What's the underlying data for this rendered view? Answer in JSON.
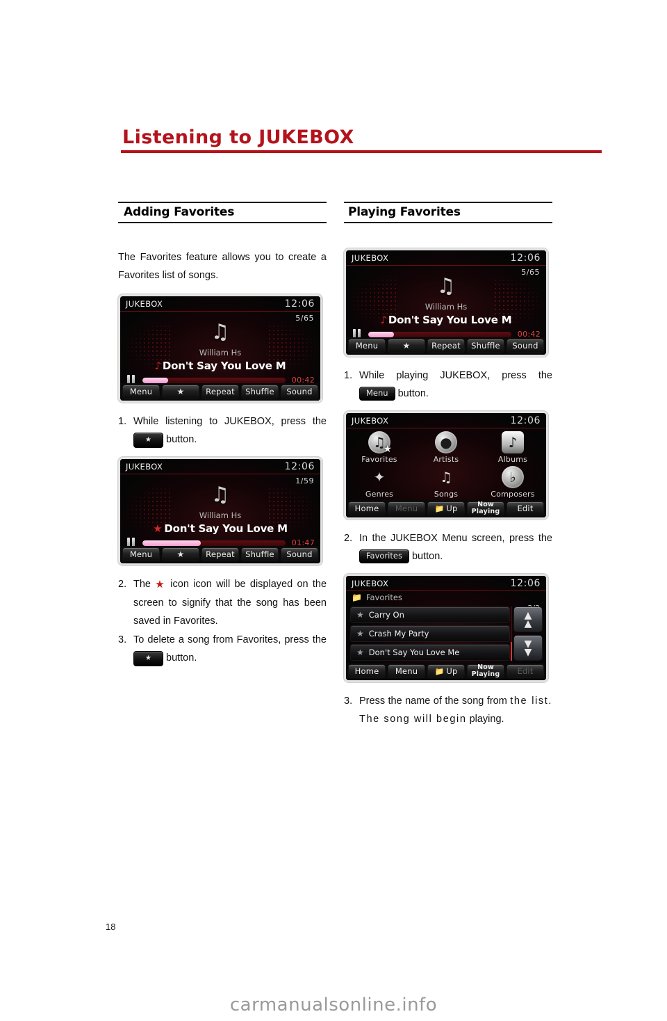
{
  "page": {
    "chapter_title": "Listening to JUKEBOX",
    "page_number": "18",
    "watermark": "carmanualsonline.info"
  },
  "left_column": {
    "heading": "Adding Favorites",
    "intro": "The Favorites feature allows you to create a Favorites list of songs.",
    "steps": [
      {
        "num": "1.",
        "text_before": "While listening to JUKEBOX, press the",
        "chip": "★",
        "text_after": "button."
      },
      {
        "num": "2.",
        "text_before": "The",
        "inline_icon": "★",
        "text_after": "icon  icon will be displayed on the screen to signify that the song has been saved in Favorites."
      },
      {
        "num": "3.",
        "text_before": "To delete a song from Favorites, press the",
        "chip": "★",
        "text_after": "button."
      }
    ],
    "shot_now_playing": {
      "source": "JUKEBOX",
      "clock": "12:06",
      "counter": "5/65",
      "artist": "William Hs",
      "title": "Don't Say You Love M",
      "lead_icon": "music-note",
      "elapsed": "00:42",
      "progress_percent": 18,
      "buttons": [
        "Menu",
        "★",
        "Repeat",
        "Shuffle",
        "Sound"
      ]
    },
    "shot_favorited": {
      "source": "JUKEBOX",
      "clock": "12:06",
      "counter": "1/59",
      "artist": "William Hs",
      "title": "Don't Say You Love M",
      "lead_icon": "red-star",
      "elapsed": "01:47",
      "progress_percent": 41,
      "buttons": [
        "Menu",
        "★",
        "Repeat",
        "Shuffle",
        "Sound"
      ]
    }
  },
  "right_column": {
    "heading": "Playing Favorites",
    "steps": [
      {
        "num": "1.",
        "text_before": "While playing JUKEBOX, press the",
        "chip": "Menu",
        "text_after": "button."
      },
      {
        "num": "2.",
        "text_before": "In the JUKEBOX Menu screen, press the",
        "chip": "Favorites",
        "text_after": "button."
      },
      {
        "num": "3.",
        "line1": "Press the name of the song from",
        "line2": "the list. The song will begin",
        "line3": "playing."
      }
    ],
    "shot_now_playing": {
      "source": "JUKEBOX",
      "clock": "12:06",
      "counter": "5/65",
      "artist": "William Hs",
      "title": "Don't Say You Love M",
      "lead_icon": "music-note",
      "elapsed": "00:42",
      "progress_percent": 18,
      "buttons": [
        "Menu",
        "★",
        "Repeat",
        "Shuffle",
        "Sound"
      ]
    },
    "shot_menu": {
      "source": "JUKEBOX",
      "clock": "12:06",
      "items": [
        {
          "label": "Favorites",
          "icon": "favorites-note-star-icon"
        },
        {
          "label": "Artists",
          "icon": "artist-person-icon"
        },
        {
          "label": "Albums",
          "icon": "album-note-icon"
        },
        {
          "label": "Genres",
          "icon": "genres-guitar-icon"
        },
        {
          "label": "Songs",
          "icon": "songs-note-icon"
        },
        {
          "label": "Composers",
          "icon": "composers-baton-icon"
        }
      ],
      "bottom_buttons": [
        {
          "label": "Home",
          "disabled": false
        },
        {
          "label": "Menu",
          "disabled": true
        },
        {
          "label": "Up",
          "disabled": false,
          "icon": "folder-up-icon"
        },
        {
          "label": "Now Playing",
          "line1": "Now",
          "line2": "Playing",
          "disabled": false
        },
        {
          "label": "Edit",
          "disabled": false
        }
      ]
    },
    "shot_list": {
      "source": "JUKEBOX",
      "clock": "12:06",
      "folder_label": "Favorites",
      "count": "3/3",
      "rows": [
        "Carry On",
        "Crash My Party",
        "Don't Say You Love Me"
      ],
      "scroll_up": "⌃",
      "scroll_down": "⌄",
      "bottom_buttons": [
        {
          "label": "Home",
          "disabled": false
        },
        {
          "label": "Menu",
          "disabled": false
        },
        {
          "label": "Up",
          "disabled": false,
          "icon": "folder-up-icon"
        },
        {
          "label": "Now Playing",
          "line1": "Now",
          "line2": "Playing",
          "disabled": false
        },
        {
          "label": "Edit",
          "disabled": true
        }
      ]
    }
  },
  "colors": {
    "brand_red": "#b4131b",
    "screen_accent": "#e3403f",
    "progress_fill": "#f49ad0"
  }
}
